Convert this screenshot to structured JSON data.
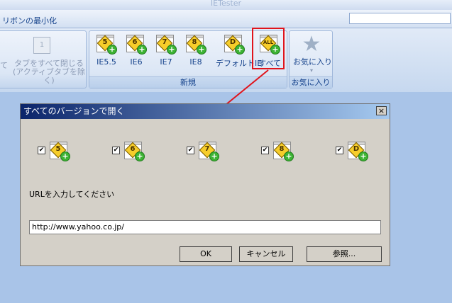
{
  "window": {
    "title": "IETester"
  },
  "ribbon_bar": {
    "minimize_label": "リボンの最小化"
  },
  "tabs_group": {
    "close_all_label_line1": "タブをすべて閉じる",
    "close_all_label_line2": "(アクティブタブを除く)",
    "left_cut_label": "て"
  },
  "new_group": {
    "label": "新規",
    "buttons": [
      {
        "icon_text": "5",
        "label": "IE5.5"
      },
      {
        "icon_text": "6",
        "label": "IE6"
      },
      {
        "icon_text": "7",
        "label": "IE7"
      },
      {
        "icon_text": "8",
        "label": "IE8"
      },
      {
        "icon_text": "D",
        "label": "デフォルトIE"
      },
      {
        "icon_text": "ALL",
        "label": "すべて"
      }
    ]
  },
  "favorites_group": {
    "label": "お気に入り",
    "button_label": "お気に入り",
    "icon": "star-icon"
  },
  "dialog": {
    "title": "すべてのバージョンで開く",
    "close_glyph": "×",
    "checkboxes": [
      {
        "icon_text": "5",
        "checked": true
      },
      {
        "icon_text": "6",
        "checked": true
      },
      {
        "icon_text": "7",
        "checked": true
      },
      {
        "icon_text": "8",
        "checked": true
      },
      {
        "icon_text": "D",
        "checked": true
      }
    ],
    "url_label": "URLを入力してください",
    "url_value": "http://www.yahoo.co.jp/",
    "ok_label": "OK",
    "cancel_label": "キャンセル",
    "browse_label": "参照..."
  },
  "colors": {
    "highlight": "#e0141c",
    "arrow": "#e0141c",
    "plus": "#3db334"
  }
}
